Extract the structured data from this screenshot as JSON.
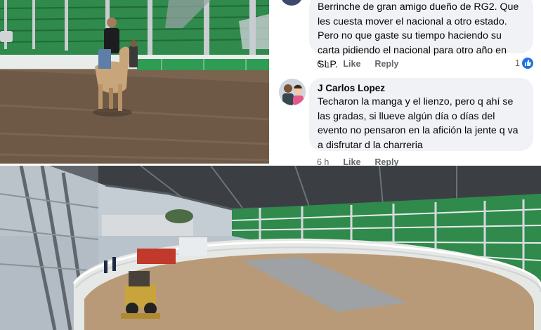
{
  "comments": [
    {
      "author": "",
      "text": "Berrinche de gran amigo dueño de RG2. Que les cuesta mover el nacional a otro estado. Pero no que gaste su tiempo haciendo su carta pidiendo el nacional para otro año en SLP.",
      "time": "6 h",
      "like_label": "Like",
      "reply_label": "Reply",
      "reaction_count": "1"
    },
    {
      "author": "J Carlos Lopez",
      "text": "Techaron la manga y el lienzo, pero q ahí se las gradas, si llueve algún día o días del evento no pensaron en la afición la jente q va a disfrutar d la charreria",
      "time": "6 h",
      "like_label": "Like",
      "reply_label": "Reply"
    }
  ],
  "colors": {
    "bubble": "#f0f2f5",
    "text": "#050505",
    "meta": "#65676b",
    "like_blue": "#1b74e4",
    "stand_green": "#2f8a4c"
  },
  "icons": {
    "reaction": "thumbs-up-icon"
  }
}
